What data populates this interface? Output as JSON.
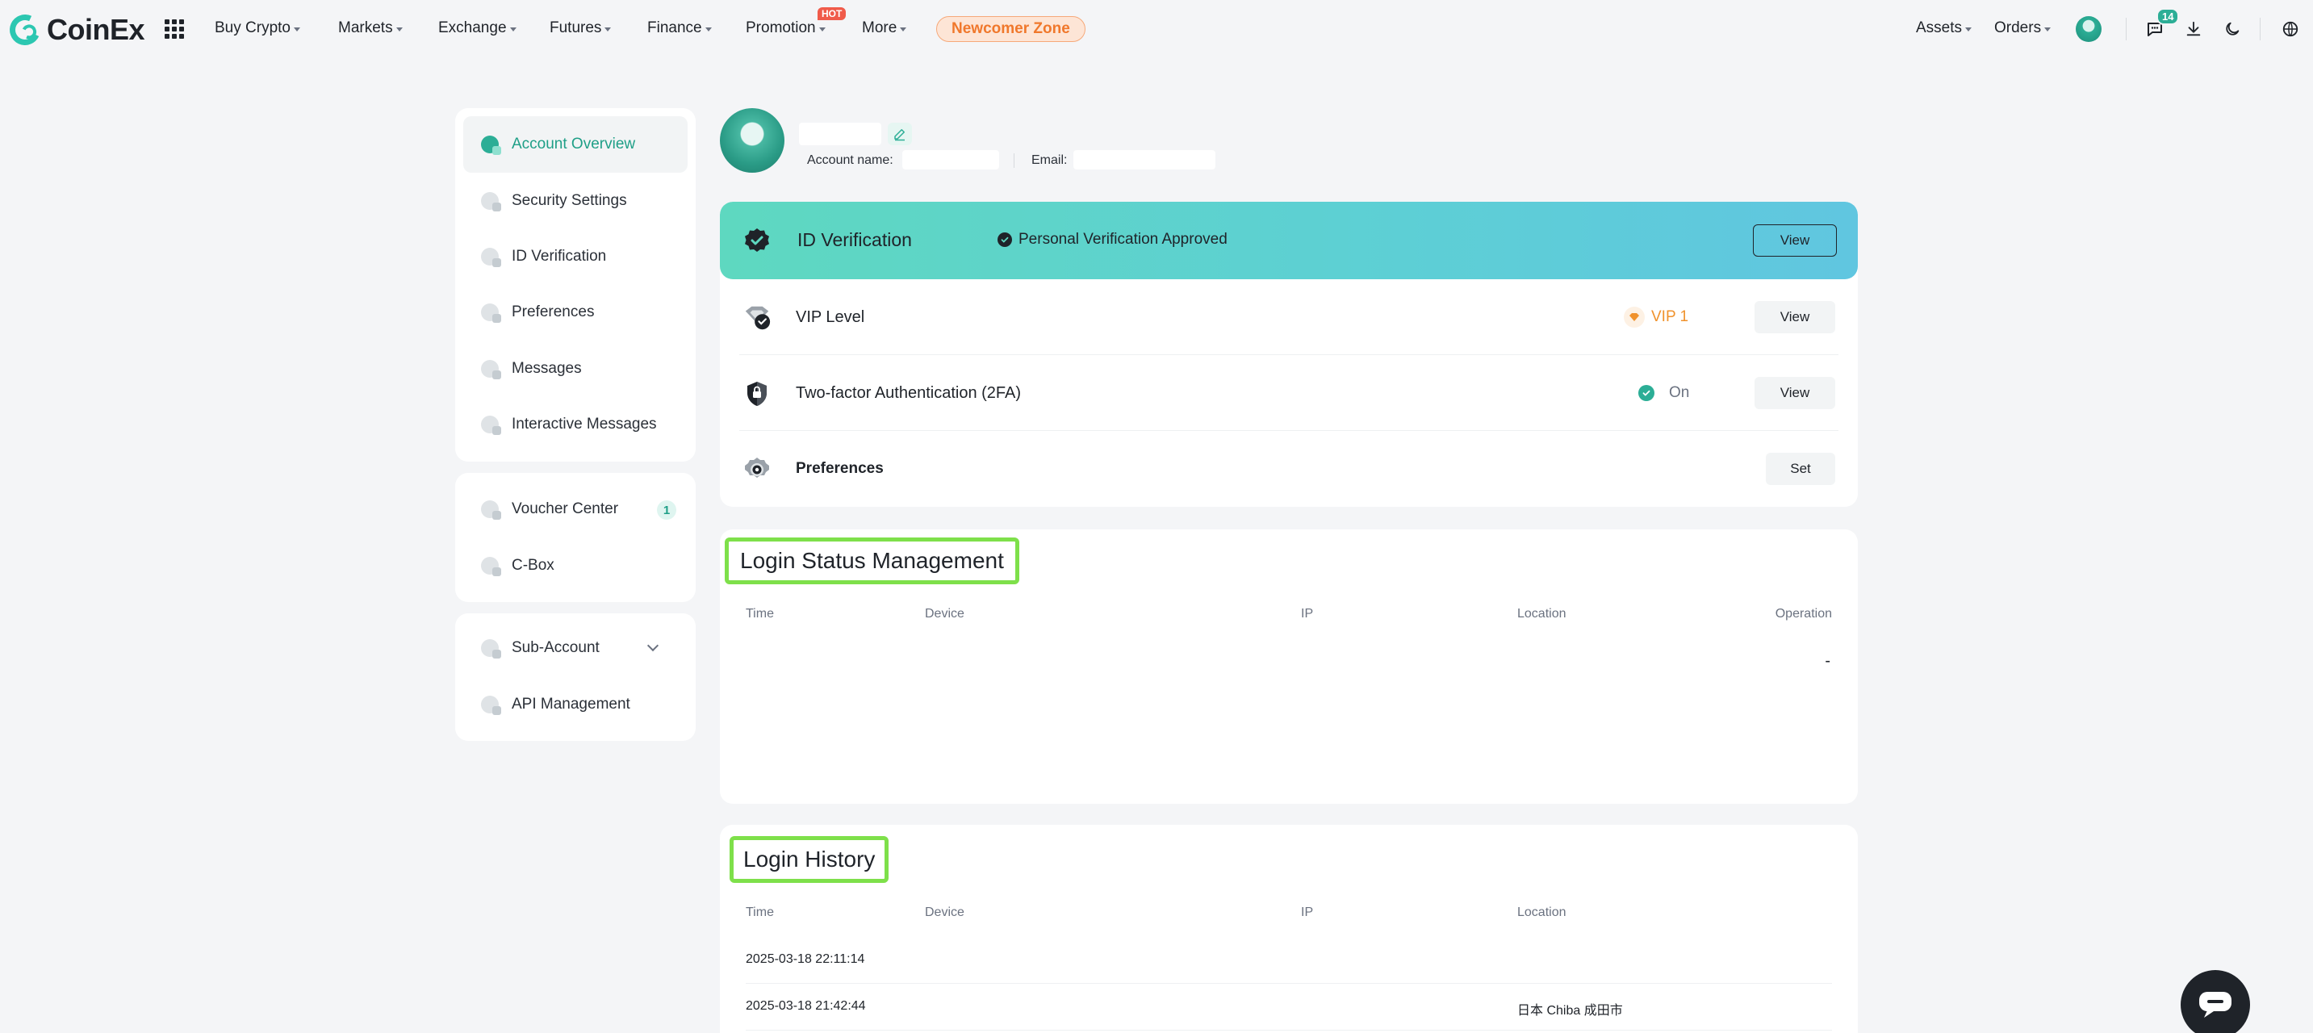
{
  "brand": {
    "name": "CoinEx"
  },
  "nav": {
    "items": [
      {
        "label": "Buy Crypto"
      },
      {
        "label": "Markets"
      },
      {
        "label": "Exchange"
      },
      {
        "label": "Futures"
      },
      {
        "label": "Finance"
      },
      {
        "label": "Promotion"
      },
      {
        "label": "More"
      }
    ],
    "hot_badge": "HOT",
    "newcomer": "Newcomer Zone",
    "right": {
      "assets": "Assets",
      "orders": "Orders",
      "message_count": "14"
    }
  },
  "sidebar": {
    "group1": [
      {
        "label": "Account Overview"
      },
      {
        "label": "Security Settings"
      },
      {
        "label": "ID Verification"
      },
      {
        "label": "Preferences"
      },
      {
        "label": "Messages"
      },
      {
        "label": "Interactive Messages"
      }
    ],
    "group2": [
      {
        "label": "Voucher Center",
        "count": "1"
      },
      {
        "label": "C-Box"
      }
    ],
    "group3": [
      {
        "label": "Sub-Account"
      },
      {
        "label": "API Management"
      }
    ]
  },
  "profile": {
    "account_name_label": "Account name:",
    "email_label": "Email:"
  },
  "overview": {
    "id_verification": {
      "title": "ID Verification",
      "status": "Personal Verification Approved",
      "button": "View"
    },
    "vip": {
      "title": "VIP Level",
      "value": "VIP 1",
      "button": "View"
    },
    "twofa": {
      "title": "Two-factor Authentication (2FA)",
      "value": "On",
      "button": "View"
    },
    "preferences": {
      "title": "Preferences",
      "button": "Set"
    }
  },
  "login_status": {
    "title": "Login Status Management",
    "columns": [
      "Time",
      "Device",
      "IP",
      "Location",
      "Operation"
    ],
    "rows": [
      {
        "operation": "-"
      }
    ]
  },
  "login_history": {
    "title": "Login History",
    "columns": [
      "Time",
      "Device",
      "IP",
      "Location"
    ],
    "rows": [
      {
        "time": "2025-03-18 22:11:14",
        "location": ""
      },
      {
        "time": "2025-03-18 21:42:44",
        "location": "日本 Chiba 成田市"
      }
    ]
  },
  "colors": {
    "accent": "#2cae96",
    "banner_start": "#5ed8c0",
    "banner_end": "#60c6e0",
    "vip": "#f0922c",
    "highlight_box": "#7ee04a",
    "hot": "#f05b4a"
  },
  "icons": [
    "apps-grid-icon",
    "caret-down-icon",
    "avatar-icon",
    "chat-icon",
    "download-icon",
    "moon-icon",
    "globe-icon",
    "edit-icon",
    "verified-badge-icon",
    "check-circle-icon",
    "vip-diamond-icon",
    "shield-icon",
    "gear-icon",
    "chevron-down-icon",
    "chat-bubble-icon"
  ]
}
